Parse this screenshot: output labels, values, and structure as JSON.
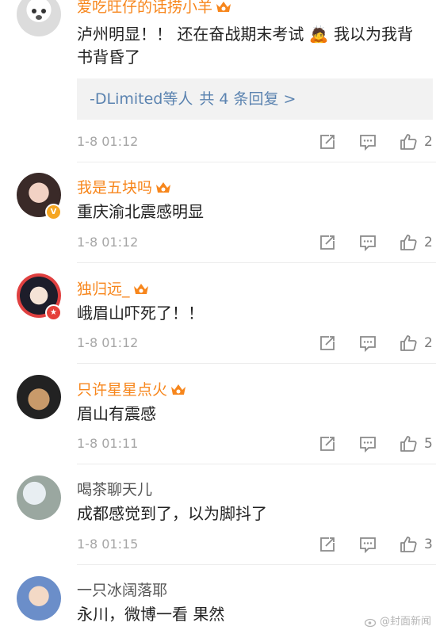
{
  "colors": {
    "vip_name": "#f7861c",
    "normal_name": "#555555",
    "link": "#5b83b0",
    "meta": "#a6a6a6"
  },
  "comments": [
    {
      "username": "爱吃旺仔的话捞小羊",
      "vip": true,
      "text": "泸州明显！！ 还在奋战期末考试 🙇 我以为我背书背昏了",
      "replies": {
        "names": "-DLimited等人",
        "count_label": "共 4 条回复 >"
      },
      "time": "1-8 01:12",
      "likes": "2"
    },
    {
      "username": "我是五块吗",
      "vip": true,
      "badge": "v",
      "text": "重庆渝北震感明显",
      "time": "1-8 01:12",
      "likes": "2"
    },
    {
      "username": "独归远_",
      "vip": true,
      "badge": "red",
      "text": "峨眉山吓死了！！",
      "time": "1-8 01:12",
      "likes": "2"
    },
    {
      "username": "只许星星点火",
      "vip": true,
      "text": "眉山有震感",
      "time": "1-8 01:11",
      "likes": "5"
    },
    {
      "username": "喝茶聊天儿",
      "vip": false,
      "text": "成都感觉到了，以为脚抖了",
      "time": "1-8 01:15",
      "likes": "3"
    },
    {
      "username": "一只冰阔落耶",
      "vip": false,
      "text": "永川，微博一看 果然"
    }
  ],
  "watermark": "@封面新闻"
}
